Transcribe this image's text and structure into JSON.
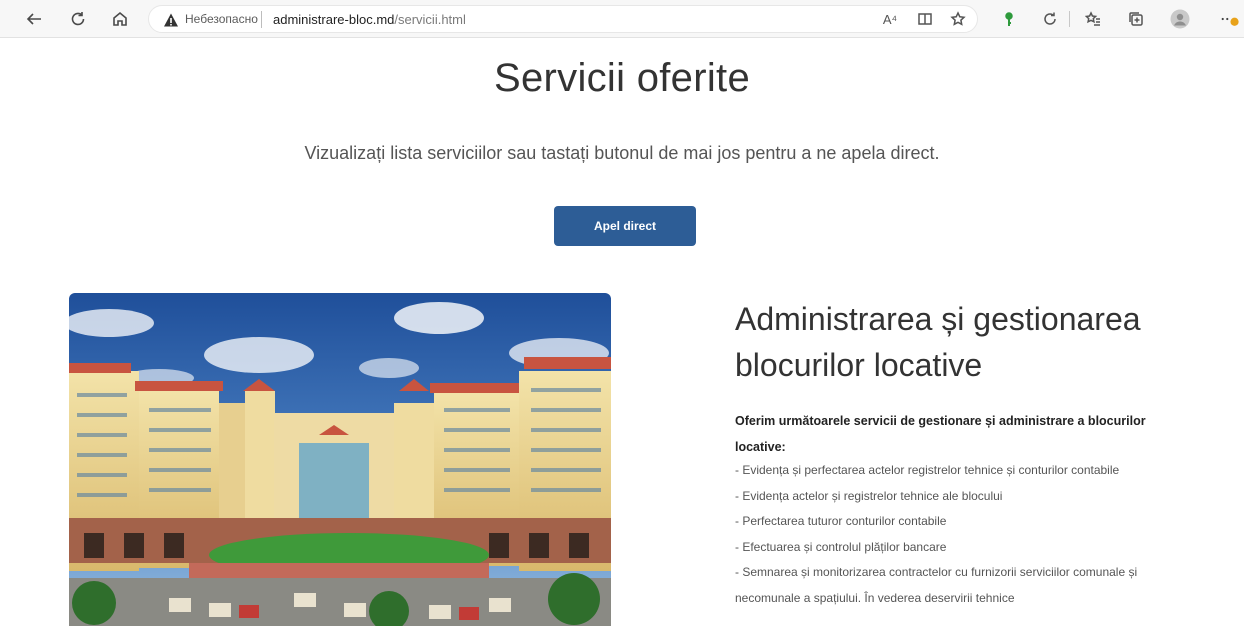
{
  "browser": {
    "insecure_label": "Небезопасно",
    "url_host": "administrare-bloc.md",
    "url_path": "/servicii.html",
    "read_aloud_label": "A⁴"
  },
  "page": {
    "title": "Servicii oferite",
    "subtitle": "Vizualizați lista serviciilor sau tastați butonul de mai jos pentru a ne apela direct.",
    "cta_label": "Apel direct"
  },
  "section": {
    "title_line1": "Administrarea și gestionarea",
    "title_line2": "blocurilor locative",
    "intro": "Oferim următoarele servicii de gestionare și administrare a blocurilor locative:",
    "items": [
      "- Evidența și perfectarea actelor registrelor tehnice și conturilor contabile",
      "- Evidența actelor și registrelor tehnice ale blocului",
      "- Perfectarea tuturor conturilor contabile",
      "- Efectuarea și controlul plăților bancare",
      "- Semnarea și monitorizarea contractelor cu furnizorii serviciilor comunale și necomunale a spațiului. În vederea deservirii tehnice"
    ]
  },
  "icons": [
    "back-icon",
    "refresh-icon",
    "home-icon",
    "warning-icon",
    "read-aloud-icon",
    "immersive-reader-icon",
    "add-favorite-icon",
    "extension-key-icon",
    "refresh-extension-icon",
    "favorites-icon",
    "collections-icon",
    "profile-icon",
    "more-icon"
  ]
}
